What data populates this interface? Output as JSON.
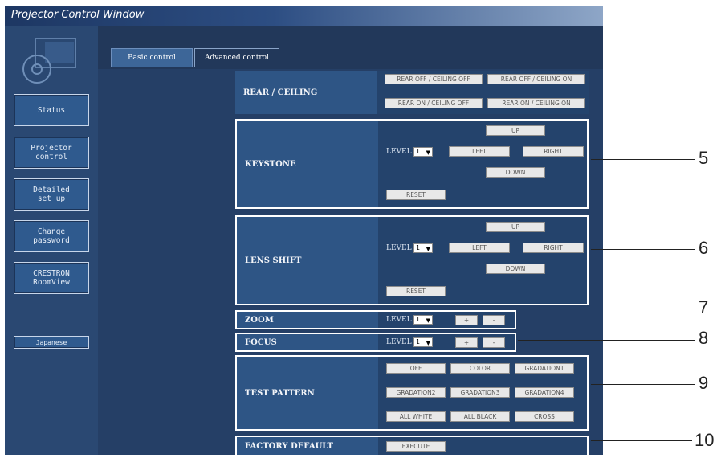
{
  "window": {
    "title": "Projector Control Window"
  },
  "sidebar": {
    "items": [
      {
        "label": "Status"
      },
      {
        "label": "Projector\ncontrol"
      },
      {
        "label": "Detailed\nset up"
      },
      {
        "label": "Change\npassword"
      },
      {
        "label": "CRESTRON\nRoomView"
      },
      {
        "label": "Japanese"
      }
    ]
  },
  "tabs": [
    {
      "label": "Basic control"
    },
    {
      "label": "Advanced control"
    }
  ],
  "rear_ceiling": {
    "label": "REAR / CEILING",
    "buttons": [
      "REAR OFF / CEILING OFF",
      "REAR OFF / CEILING ON",
      "REAR ON / CEILING OFF",
      "REAR ON / CEILING ON"
    ]
  },
  "keystone": {
    "label": "KEYSTONE",
    "level_label": "LEVEL",
    "level_value": "1",
    "up": "UP",
    "left": "LEFT",
    "right": "RIGHT",
    "down": "DOWN",
    "reset": "RESET"
  },
  "lens_shift": {
    "label": "LENS SHIFT",
    "level_label": "LEVEL",
    "level_value": "1",
    "up": "UP",
    "left": "LEFT",
    "right": "RIGHT",
    "down": "DOWN",
    "reset": "RESET"
  },
  "zoom": {
    "label": "ZOOM",
    "level_label": "LEVEL",
    "level_value": "1",
    "plus": "+",
    "minus": "-"
  },
  "focus": {
    "label": "FOCUS",
    "level_label": "LEVEL",
    "level_value": "1",
    "plus": "+",
    "minus": "-"
  },
  "test_pattern": {
    "label": "TEST PATTERN",
    "buttons": [
      "OFF",
      "COLOR",
      "GRADATION1",
      "GRADATION2",
      "GRADATION3",
      "GRADATION4",
      "ALL WHITE",
      "ALL BLACK",
      "CROSS"
    ]
  },
  "factory_default": {
    "label": "FACTORY DEFAULT",
    "execute": "EXECUTE"
  },
  "callouts": [
    "5",
    "6",
    "7",
    "8",
    "9",
    "10"
  ]
}
